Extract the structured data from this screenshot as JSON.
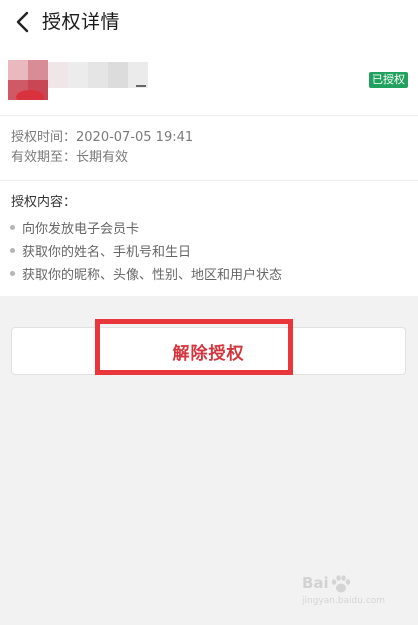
{
  "header": {
    "title": "授权详情",
    "back_icon": "chevron-left-icon"
  },
  "app": {
    "status_badge": "已授权",
    "badge_color": "#20a15e"
  },
  "authorization": {
    "time": "授权时间：2020-07-05 19:41",
    "validity": "有效期至：长期有效"
  },
  "content": {
    "title": "授权内容：",
    "items": [
      {
        "label": "向你发放电子会员卡"
      },
      {
        "label": "获取你的姓名、手机号和生日"
      },
      {
        "label": "获取你的昵称、头像、性别、地区和用户状态"
      }
    ]
  },
  "actions": {
    "revoke_label": "解除授权",
    "revoke_color": "#d3363d",
    "highlight_color": "#e8363a"
  },
  "watermark": {
    "brand": "Bai",
    "url": "jingyan.baidu.com"
  }
}
